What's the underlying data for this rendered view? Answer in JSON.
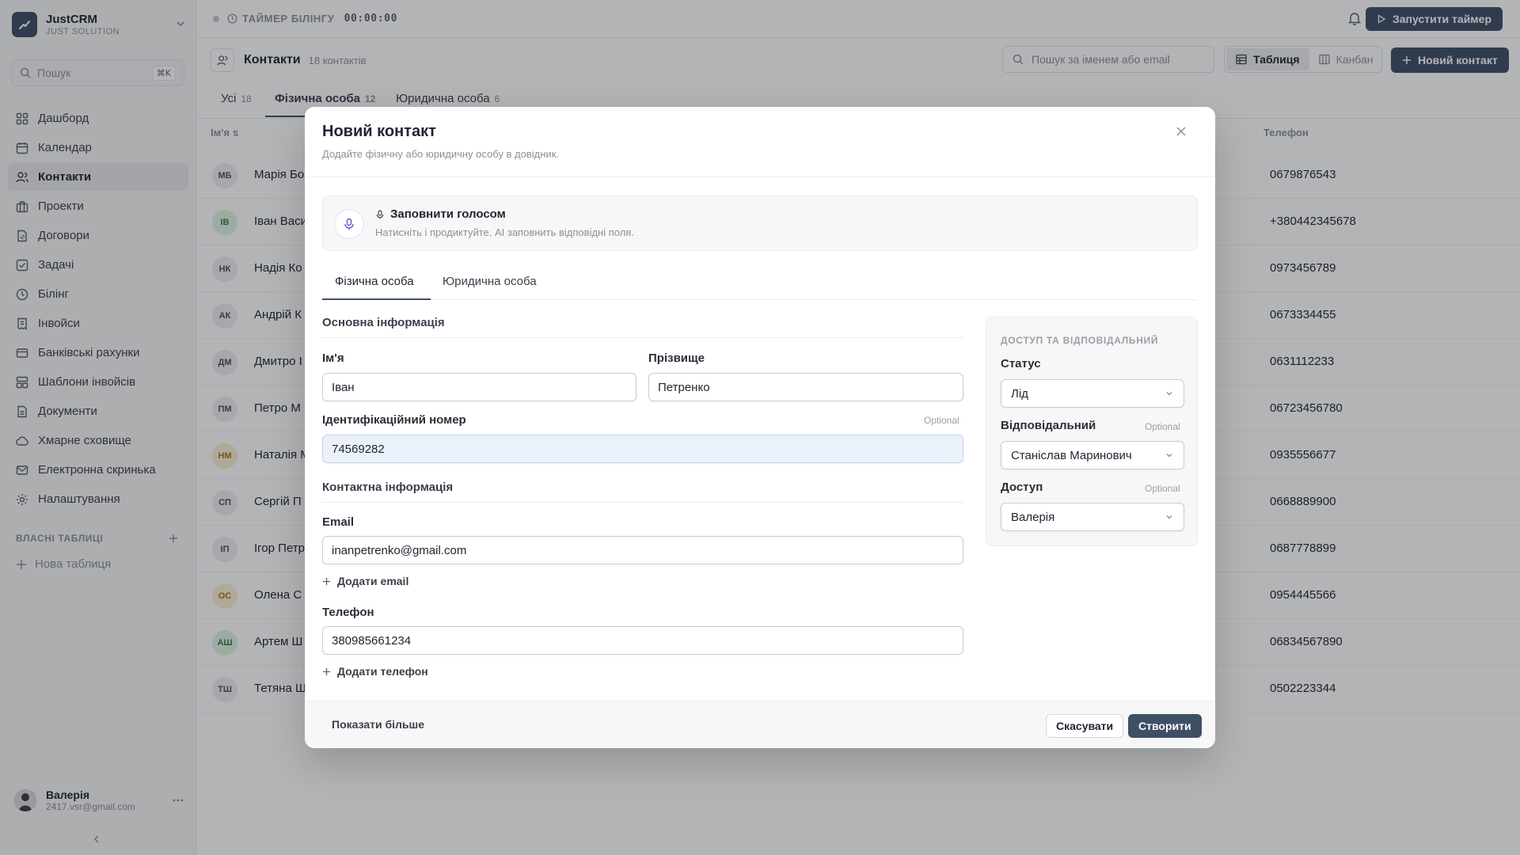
{
  "app": {
    "name": "JustCRM",
    "org": "JUST SOLUTION"
  },
  "sidebar": {
    "search_placeholder": "Пошук",
    "search_shortcut": "⌘K",
    "items": [
      {
        "label": "Дашборд",
        "icon": "dashboard-icon"
      },
      {
        "label": "Календар",
        "icon": "calendar-icon"
      },
      {
        "label": "Контакти",
        "icon": "users-icon",
        "active": true
      },
      {
        "label": "Проекти",
        "icon": "projects-icon"
      },
      {
        "label": "Договори",
        "icon": "contracts-icon"
      },
      {
        "label": "Задачі",
        "icon": "tasks-icon"
      },
      {
        "label": "Білінг",
        "icon": "clock-icon"
      },
      {
        "label": "Інвойси",
        "icon": "invoice-icon"
      },
      {
        "label": "Банківські рахунки",
        "icon": "bank-card-icon"
      },
      {
        "label": "Шаблони інвойсів",
        "icon": "template-icon"
      },
      {
        "label": "Документи",
        "icon": "document-icon"
      },
      {
        "label": "Хмарне сховище",
        "icon": "cloud-icon"
      },
      {
        "label": "Електронна скринька",
        "icon": "mail-icon"
      },
      {
        "label": "Налаштування",
        "icon": "gear-icon"
      }
    ],
    "custom_tables_title": "ВЛАСНІ ТАБЛИЦІ",
    "new_table_label": "Нова таблиця",
    "user": {
      "name": "Валерія",
      "email": "2417.vsr@gmail.com"
    }
  },
  "topbar": {
    "timer_label": "ТАЙМЕР БІЛІНГУ",
    "timer_value": "00:00:00",
    "start_timer_label": "Запустити таймер"
  },
  "page": {
    "title": "Контакти",
    "count": "18 контактів",
    "search_placeholder": "Пошук за іменем або email",
    "view_table": "Таблиця",
    "view_kanban": "Канбан",
    "new_contact_label": "Новий контакт",
    "tabs": [
      {
        "label": "Усі",
        "count": "18"
      },
      {
        "label": "Фізична особа",
        "count": "12"
      },
      {
        "label": "Юридична особа",
        "count": "6"
      }
    ],
    "columns": {
      "name": "Ім'я",
      "phone": "Телефон"
    },
    "rows": [
      {
        "initials": "МБ",
        "name": "Марія Бо",
        "phone": "0679876543",
        "color": "#eeeef1",
        "text": "#4a4e57"
      },
      {
        "initials": "ІВ",
        "name": "Іван Васи",
        "phone": "+380442345678",
        "color": "#dff3e4",
        "text": "#2f7d45"
      },
      {
        "initials": "НК",
        "name": "Надія Ко",
        "phone": "0973456789",
        "color": "#eeeef1",
        "text": "#4a4e57"
      },
      {
        "initials": "АК",
        "name": "Андрій К",
        "phone": "0673334455",
        "color": "#eeeef1",
        "text": "#4a4e57"
      },
      {
        "initials": "ДМ",
        "name": "Дмитро I",
        "phone": "0631112233",
        "color": "#eeeef1",
        "text": "#4a4e57"
      },
      {
        "initials": "ПМ",
        "name": "Петро М",
        "phone": "06723456780",
        "color": "#eeeef1",
        "text": "#4a4e57"
      },
      {
        "initials": "НМ",
        "name": "Наталія М",
        "phone": "0935556677",
        "color": "#fbefd2",
        "text": "#a4731a"
      },
      {
        "initials": "СП",
        "name": "Сергій П",
        "phone": "0668889900",
        "color": "#eeeef1",
        "text": "#4a4e57"
      },
      {
        "initials": "ІП",
        "name": "Ігор Петр",
        "phone": "0687778899",
        "color": "#eeeef1",
        "text": "#4a4e57"
      },
      {
        "initials": "ОС",
        "name": "Олена С",
        "phone": "0954445566",
        "color": "#fbefd2",
        "text": "#a4731a"
      },
      {
        "initials": "АШ",
        "name": "Артем Ш",
        "phone": "06834567890",
        "color": "#dff3e4",
        "text": "#2f7d45"
      },
      {
        "initials": "ТШ",
        "name": "Тетяна Ш",
        "phone": "0502223344",
        "color": "#eeeef1",
        "text": "#4a4e57"
      }
    ]
  },
  "modal": {
    "title": "Новий контакт",
    "subtitle": "Додайте фізичну або юридичну особу в довідник.",
    "voice_title": "Заповнити голосом",
    "voice_hint": "Натисніть і продиктуйте. AI заповнить відповідні поля.",
    "tabs": [
      "Фізична особа",
      "Юридична особа"
    ],
    "section_basic": "Основна інформація",
    "first_name_label": "Ім'я",
    "first_name_value": "Іван",
    "last_name_label": "Прізвище",
    "last_name_value": "Петренко",
    "id_label": "Ідентифікаційний номер",
    "id_value": "74569282",
    "optional": "Optional",
    "section_contact": "Контактна інформація",
    "email_label": "Email",
    "email_value": "inanpetrenko@gmail.com",
    "add_email": "Додати email",
    "phone_label": "Телефон",
    "phone_value": "380985661234",
    "add_phone": "Додати телефон",
    "access_title": "ДОСТУП ТА ВІДПОВІДАЛЬНИЙ",
    "status_label": "Статус",
    "status_value": "Лід",
    "responsible_label": "Відповідальний",
    "responsible_value": "Станіслав Маринович",
    "access_label": "Доступ",
    "access_value": "Валерія",
    "show_more": "Показати більше",
    "cancel": "Скасувати",
    "create": "Створити"
  },
  "colors": {
    "accent": "#3f4f66",
    "voice": "#7b4bd1"
  }
}
